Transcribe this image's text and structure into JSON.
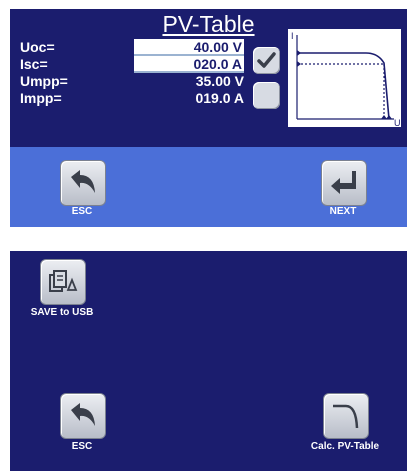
{
  "screen1": {
    "title": "PV-Table",
    "params": [
      {
        "label": "Uoc=",
        "value": "40.00 V",
        "boxed": true
      },
      {
        "label": "Isc=",
        "value": "020.0 A",
        "boxed": true
      },
      {
        "label": "Umpp=",
        "value": "35.00 V",
        "boxed": false
      },
      {
        "label": "Impp=",
        "value": "019.0 A",
        "boxed": false
      }
    ],
    "mpp_checkbox_checked": true,
    "mpp_checkbox2_checked": false,
    "graph": {
      "y_axis_label": "I",
      "x_axis_label": "U"
    },
    "esc_label": "ESC",
    "next_label": "NEXT"
  },
  "screen2": {
    "save_usb_label": "SAVE to USB",
    "esc_label": "ESC",
    "calc_label": "Calc. PV-Table"
  },
  "colors": {
    "screen_bg": "#1b1d6e",
    "button_bar": "#4b6fd8",
    "text": "#ffffff"
  },
  "icons": {
    "esc": "undo-arrow-icon",
    "next": "enter-arrow-icon",
    "save_usb": "usb-save-icon",
    "calc": "curve-icon",
    "checkbox": "checkmark-icon"
  }
}
